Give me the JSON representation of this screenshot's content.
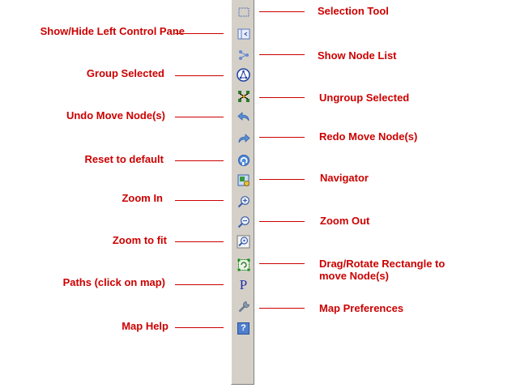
{
  "toolbar": {
    "tools": [
      {
        "name": "selection-tool-button",
        "icon": "selection-rectangle-icon"
      },
      {
        "name": "show-hide-left-pane-button",
        "icon": "left-pane-toggle-icon"
      },
      {
        "name": "show-node-list-button",
        "icon": "node-list-icon"
      },
      {
        "name": "group-selected-button",
        "icon": "group-icon"
      },
      {
        "name": "ungroup-selected-button",
        "icon": "ungroup-icon"
      },
      {
        "name": "undo-move-button",
        "icon": "undo-arrow-icon"
      },
      {
        "name": "redo-move-button",
        "icon": "redo-arrow-icon"
      },
      {
        "name": "reset-default-button",
        "icon": "reset-icon"
      },
      {
        "name": "navigator-button",
        "icon": "navigator-icon"
      },
      {
        "name": "zoom-in-button",
        "icon": "zoom-in-icon"
      },
      {
        "name": "zoom-out-button",
        "icon": "zoom-out-icon"
      },
      {
        "name": "zoom-to-fit-button",
        "icon": "zoom-fit-icon"
      },
      {
        "name": "drag-rotate-button",
        "icon": "rotate-rectangle-icon"
      },
      {
        "name": "paths-button",
        "icon": "paths-p-icon"
      },
      {
        "name": "map-preferences-button",
        "icon": "wrench-icon"
      },
      {
        "name": "map-help-button",
        "icon": "help-icon"
      }
    ]
  },
  "labels": {
    "selection_tool": "Selection Tool",
    "show_hide_left": "Show/Hide Left Control Pane",
    "show_node_list": "Show Node List",
    "group_selected": "Group Selected",
    "ungroup_selected": "Ungroup Selected",
    "undo_move": "Undo Move Node(s)",
    "redo_move": "Redo Move Node(s)",
    "reset_default": "Reset to default",
    "navigator": "Navigator",
    "zoom_in": "Zoom In",
    "zoom_out": "Zoom Out",
    "zoom_fit": "Zoom to fit",
    "drag_rotate_line1": "Drag/Rotate Rectangle to",
    "drag_rotate_line2": "move Node(s)",
    "paths": "Paths (click on map)",
    "map_preferences": "Map Preferences",
    "map_help": "Map Help"
  },
  "colors": {
    "annotation": "#cc0000",
    "toolbar_bg": "#d4d0c8",
    "icon_blue": "#1f4fb5"
  },
  "icon_glyphs": {
    "paths": "P",
    "help": "?"
  }
}
